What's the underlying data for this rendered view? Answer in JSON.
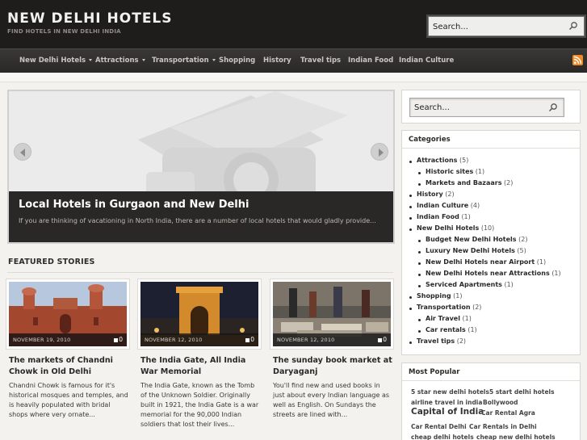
{
  "site": {
    "title": "NEW DELHI HOTELS",
    "tagline": "FIND HOTELS IN NEW DELHI INDIA"
  },
  "header_search": {
    "placeholder": "Search..."
  },
  "nav": {
    "items": [
      {
        "label": "New Delhi Hotels",
        "has_dropdown": true
      },
      {
        "label": "Attractions",
        "has_dropdown": true
      },
      {
        "label": "Transportation",
        "has_dropdown": true
      },
      {
        "label": "Shopping",
        "has_dropdown": false
      },
      {
        "label": "History",
        "has_dropdown": false
      },
      {
        "label": "Travel tips",
        "has_dropdown": false
      },
      {
        "label": "Indian Food",
        "has_dropdown": false
      },
      {
        "label": "Indian Culture",
        "has_dropdown": false
      }
    ],
    "rss_icon": "rss-icon"
  },
  "slider": {
    "title": "Local Hotels in Gurgaon and New Delhi",
    "excerpt": "If you are thinking of vacationing in North India, there are a number of local hotels that would gladly provide..."
  },
  "featured": {
    "heading": "FEATURED STORIES",
    "stories": [
      {
        "date": "NOVEMBER 19, 2010",
        "comments": "0",
        "title": "The markets of Chandni Chowk in Old Delhi",
        "excerpt": "Chandni Chowk is famous for it's historical mosques and temples, and is heavily populated with bridal shops where very ornate..."
      },
      {
        "date": "NOVEMBER 12, 2010",
        "comments": "0",
        "title": "The India Gate, All India War Memorial",
        "excerpt": "The India Gate, known as the Tomb of the Unknown Soldier. Originally built in 1921, the India Gate is a war memorial for the 90,000 Indian soldiers that lost their lives..."
      },
      {
        "date": "NOVEMBER 12, 2010",
        "comments": "0",
        "title": "The sunday book market at Daryaganj",
        "excerpt": "You'll find new and used books in just about every Indian language as well as English. On Sundays the streets are lined with..."
      }
    ]
  },
  "sidebar": {
    "search_placeholder": "Search...",
    "categories_title": "Categories",
    "categories": [
      {
        "name": "Attractions",
        "count": "(5)",
        "level": 0
      },
      {
        "name": "Historic sites",
        "count": "(1)",
        "level": 1
      },
      {
        "name": "Markets and Bazaars",
        "count": "(2)",
        "level": 1
      },
      {
        "name": "History",
        "count": "(2)",
        "level": 0
      },
      {
        "name": "Indian Culture",
        "count": "(4)",
        "level": 0
      },
      {
        "name": "Indian Food",
        "count": "(1)",
        "level": 0
      },
      {
        "name": "New Delhi Hotels",
        "count": "(10)",
        "level": 0
      },
      {
        "name": "Budget New Delhi Hotels",
        "count": "(2)",
        "level": 1
      },
      {
        "name": "Luxury New Delhi Hotels",
        "count": "(5)",
        "level": 1
      },
      {
        "name": "New Delhi Hotels near Airport",
        "count": "(1)",
        "level": 1
      },
      {
        "name": "New Delhi Hotels near Attractions",
        "count": "(1)",
        "level": 1
      },
      {
        "name": "Serviced Apartments",
        "count": "(1)",
        "level": 1
      },
      {
        "name": "Shopping",
        "count": "(1)",
        "level": 0
      },
      {
        "name": "Transportation",
        "count": "(2)",
        "level": 0
      },
      {
        "name": "Air Travel",
        "count": "(1)",
        "level": 1
      },
      {
        "name": "Car rentals",
        "count": "(1)",
        "level": 1
      },
      {
        "name": "Travel tips",
        "count": "(2)",
        "level": 0
      }
    ],
    "popular_title": "Most Popular",
    "popular_tags": [
      [
        "5 star new delhi hotels",
        "5 start delhi hotels"
      ],
      [
        "airline travel in india",
        "Bollywood"
      ],
      [
        "Capital of India",
        "Car Rental Agra"
      ],
      [
        "Car Rental Delhi",
        "Car Rentals in Delhi"
      ],
      [
        "cheap delhi hotels",
        "cheap new delhi hotels"
      ]
    ]
  }
}
